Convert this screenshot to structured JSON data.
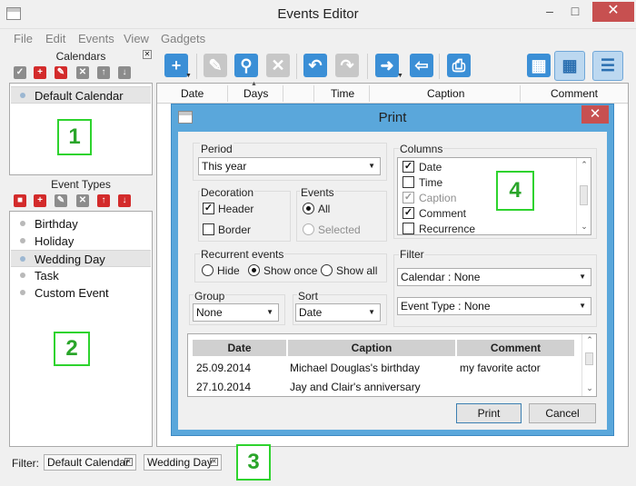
{
  "window": {
    "title": "Events Editor"
  },
  "menu": [
    "File",
    "Edit",
    "Events",
    "View",
    "Gadgets"
  ],
  "calendars": {
    "title": "Calendars",
    "items": [
      "Default Calendar"
    ],
    "callout": "1"
  },
  "event_types": {
    "title": "Event Types",
    "items": [
      "Birthday",
      "Holiday",
      "Wedding Day",
      "Task",
      "Custom Event"
    ],
    "selected": "Wedding Day",
    "callout": "2"
  },
  "grid": {
    "columns": [
      "Date",
      "Days",
      "Time",
      "Caption",
      "Comment"
    ]
  },
  "filter_bar": {
    "label": "Filter:",
    "chips": [
      "Default Calendar",
      "Wedding Day"
    ],
    "callout": "3"
  },
  "print_dialog": {
    "title": "Print",
    "period": {
      "label": "Period",
      "value": "This year"
    },
    "decoration": {
      "label": "Decoration",
      "header": "Header",
      "border": "Border",
      "header_checked": true,
      "border_checked": false
    },
    "events": {
      "label": "Events",
      "all": "All",
      "selected": "Selected"
    },
    "recurrent": {
      "label": "Recurrent events",
      "hide": "Hide",
      "show_once": "Show once",
      "show_all": "Show all",
      "value": "Show once"
    },
    "group": {
      "label": "Group",
      "value": "None"
    },
    "sort": {
      "label": "Sort",
      "value": "Date"
    },
    "columns": {
      "label": "Columns",
      "items": [
        {
          "name": "Date",
          "checked": true,
          "enabled": true
        },
        {
          "name": "Time",
          "checked": false,
          "enabled": true
        },
        {
          "name": "Caption",
          "checked": true,
          "enabled": false
        },
        {
          "name": "Comment",
          "checked": true,
          "enabled": true
        },
        {
          "name": "Recurrence",
          "checked": false,
          "enabled": true
        }
      ],
      "callout": "4"
    },
    "filter": {
      "label": "Filter",
      "calendar": "Calendar : None",
      "event_type": "Event Type : None"
    },
    "preview": {
      "headers": [
        "Date",
        "Caption",
        "Comment"
      ],
      "rows": [
        [
          "25.09.2014",
          "Michael Douglas's birthday",
          "my favorite actor"
        ],
        [
          "27.10.2014",
          "Jay and Clair's anniversary",
          ""
        ]
      ]
    },
    "print_button": "Print",
    "cancel_button": "Cancel"
  },
  "colors": {
    "accent": "#3b8fd6",
    "dialog_frame": "#5aa7db",
    "close_red": "#c75050",
    "callout_green": "#2ed32e"
  }
}
